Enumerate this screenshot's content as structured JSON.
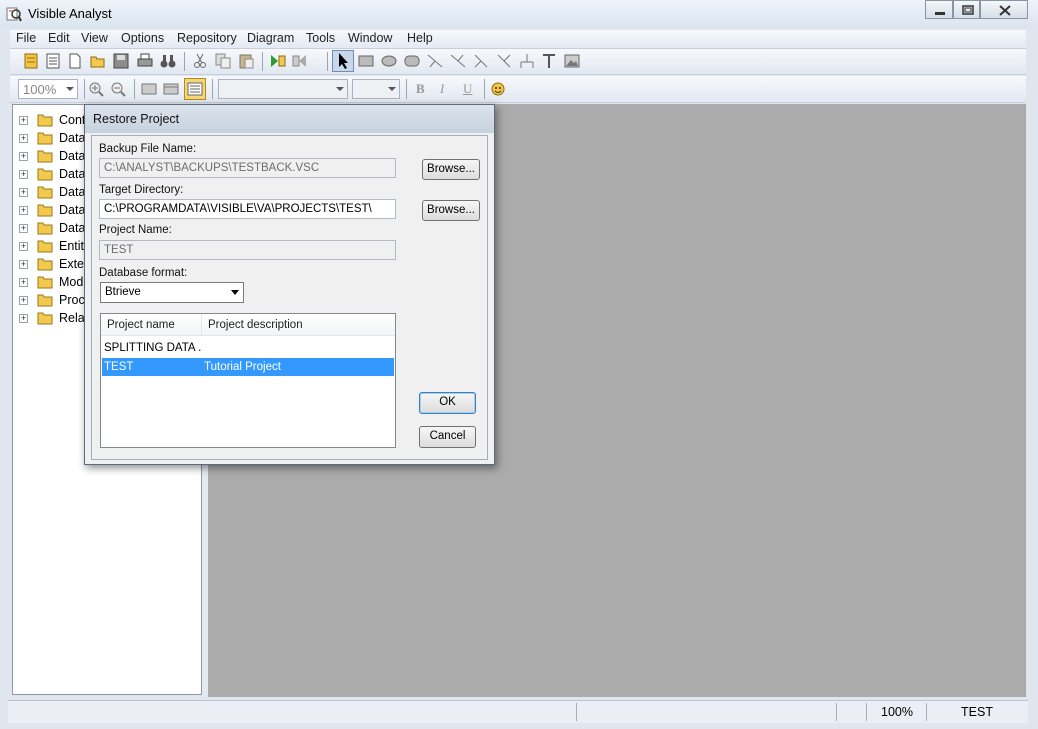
{
  "window": {
    "title": "Visible Analyst"
  },
  "menu": [
    "File",
    "Edit",
    "View",
    "Options",
    "Repository",
    "Diagram",
    "Tools",
    "Window",
    "Help"
  ],
  "toolbar2": {
    "zoom_value": "100%",
    "bold": "B",
    "italic": "I",
    "underline": "U"
  },
  "tree": {
    "items": [
      "Cont",
      "Data",
      "Data",
      "Data",
      "Data",
      "Data",
      "Data",
      "Entity",
      "Exter",
      "Mod",
      "Proc",
      "Relat"
    ]
  },
  "dialog": {
    "title": "Restore Project",
    "backup_label": "Backup File Name:",
    "backup_value": "C:\\ANALYST\\BACKUPS\\TESTBACK.VSC",
    "browse_label": "Browse...",
    "target_label": "Target Directory:",
    "target_value": "C:\\PROGRAMDATA\\VISIBLE\\VA\\PROJECTS\\TEST\\",
    "project_name_label": "Project Name:",
    "project_name_value": "TEST",
    "db_format_label": "Database format:",
    "db_format_value": "Btrieve",
    "columns": [
      "Project name",
      "Project description"
    ],
    "rows": [
      {
        "name": "SPLITTING DATA ...",
        "description": ""
      },
      {
        "name": "TEST",
        "description": "Tutorial Project",
        "selected": true
      }
    ],
    "ok_label": "OK",
    "cancel_label": "Cancel"
  },
  "status": {
    "zoom": "100%",
    "project": "TEST"
  },
  "colors": {
    "selection": "#3399ff",
    "workspace": "#ababab",
    "folder": "#f2c94c"
  }
}
